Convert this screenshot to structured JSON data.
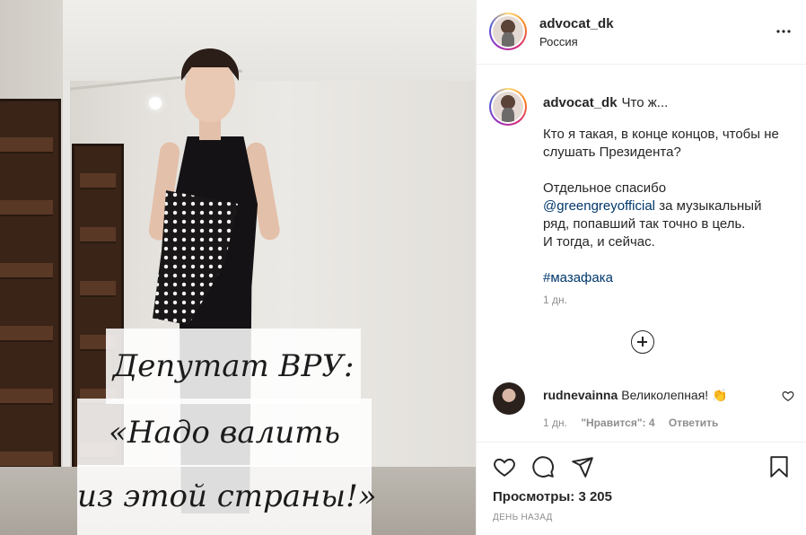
{
  "media": {
    "caption_line_1": "Депутат ВРУ:",
    "caption_line_2": "«Надо валить",
    "caption_line_3": "из этой страны!»"
  },
  "post": {
    "username": "advocat_dk",
    "location": "Россия",
    "more_icon": "more-horizontal-icon"
  },
  "caption": {
    "username": "advocat_dk",
    "lead": "Что ж...",
    "paragraph_1": "Кто я такая, в конце концов, чтобы не слушать Президента?",
    "paragraph_2_before": "Отдельное спасибо",
    "mention": "@greengreyofficial",
    "paragraph_2_after": " за музыкальный ряд, попавший так точно в цель.",
    "paragraph_2_end": "И тогда, и сейчас.",
    "hashtag": "#мазафака",
    "age": "1 дн."
  },
  "load_more_icon": "plus-circle-icon",
  "comments": [
    {
      "username": "rudnevainna",
      "text": "Великолепная! 👏",
      "age": "1 дн.",
      "likes": "\"Нравится\": 4",
      "reply": "Ответить"
    }
  ],
  "actions": {
    "like_icon": "heart-icon",
    "comment_icon": "comment-icon",
    "share_icon": "share-icon",
    "save_icon": "bookmark-icon",
    "views_label": "Просмотры:",
    "views_count": "3 205",
    "date": "ДЕНЬ НАЗАД"
  }
}
